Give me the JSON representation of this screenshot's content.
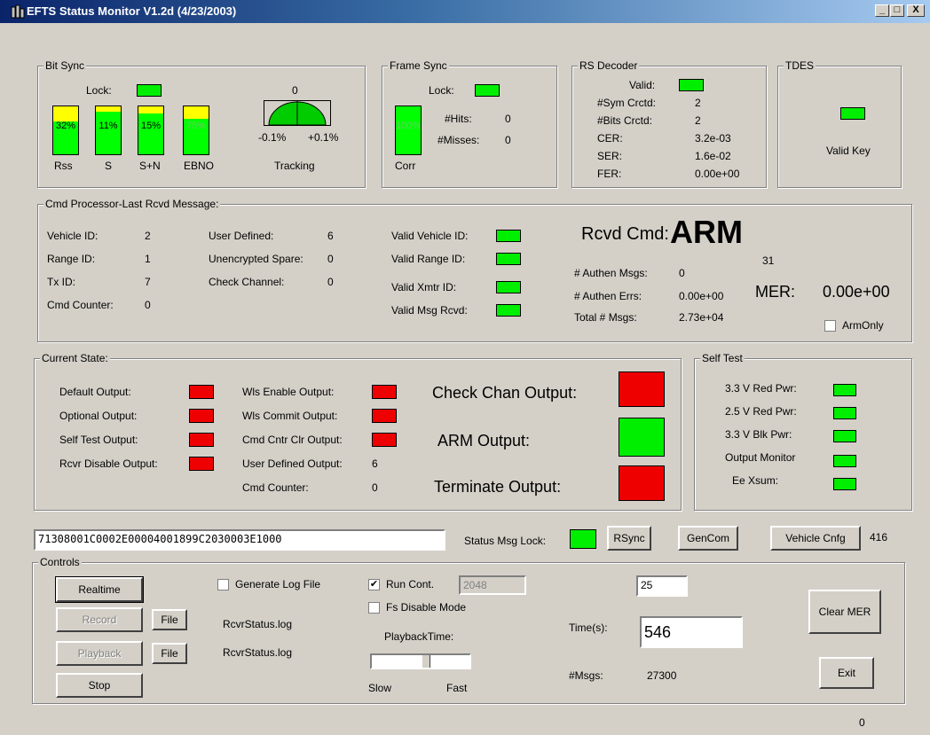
{
  "window": {
    "title": "EFTS Status Monitor V1.2d (4/23/2003)",
    "min": "_",
    "max": "□",
    "close": "X"
  },
  "bitsync": {
    "label": "Bit Sync",
    "lock_label": "Lock:",
    "bars": [
      {
        "pct": "32%",
        "label": "Rss",
        "value": 0.32
      },
      {
        "pct": "11%",
        "label": "S",
        "value": 0.11
      },
      {
        "pct": "15%",
        "label": "S+N",
        "value": 0.15
      },
      {
        "pct": "75%",
        "label": "EBNO",
        "value": 0.75
      }
    ],
    "tracking_value": "0",
    "tracking_min": "-0.1%",
    "tracking_max": "+0.1%",
    "tracking_label": "Tracking"
  },
  "framesync": {
    "label": "Frame Sync",
    "lock_label": "Lock:",
    "corr_pct": "100%",
    "corr_label": "Corr",
    "hits_label": "#Hits:",
    "hits": "0",
    "misses_label": "#Misses:",
    "misses": "0"
  },
  "rs": {
    "label": "RS Decoder",
    "valid_label": "Valid:",
    "rows": [
      {
        "k": "#Sym Crctd:",
        "v": "2"
      },
      {
        "k": "#Bits Crctd:",
        "v": "2"
      },
      {
        "k": "CER:",
        "v": "3.2e-03"
      },
      {
        "k": "SER:",
        "v": "1.6e-02"
      },
      {
        "k": "FER:",
        "v": "0.00e+00"
      }
    ]
  },
  "tdes": {
    "label": "TDES",
    "valid_key": "Valid Key"
  },
  "cmd": {
    "label": "Cmd Processor-Last Rcvd Message:",
    "left": [
      {
        "k": "Vehicle ID:",
        "v": "2"
      },
      {
        "k": "Range ID:",
        "v": "1"
      },
      {
        "k": "Tx ID:",
        "v": "7"
      },
      {
        "k": "Cmd Counter:",
        "v": "0"
      }
    ],
    "mid": [
      {
        "k": "User Defined:",
        "v": "6"
      },
      {
        "k": "Unencrypted Spare:",
        "v": "0"
      },
      {
        "k": "Check Channel:",
        "v": "0"
      }
    ],
    "valids": [
      "Valid Vehicle ID:",
      "Valid Range ID:",
      "Valid Xmtr ID:",
      "Valid Msg Rcvd:"
    ],
    "rcvd_label": "Rcvd Cmd:",
    "rcvd_value": "ARM",
    "rcvd_num": "31",
    "authen_msgs_label": "# Authen Msgs:",
    "authen_msgs": "0",
    "authen_errs_label": "# Authen Errs:",
    "authen_errs": "0.00e+00",
    "total_label": "Total # Msgs:",
    "total": "2.73e+04",
    "mer_label": "MER:",
    "mer": "0.00e+00",
    "armonly": "ArmOnly"
  },
  "state": {
    "label": "Current State:",
    "left": [
      "Default Output:",
      "Optional Output:",
      "Self Test Output:",
      "Rcvr Disable Output:"
    ],
    "mid": [
      "Wls Enable Output:",
      "Wls Commit Output:",
      "Cmd Cntr Clr Output:"
    ],
    "user_defined_label": "User Defined Output:",
    "user_defined": "6",
    "cmd_counter_label": "Cmd Counter:",
    "cmd_counter": "0",
    "check_chan": "Check Chan Output:",
    "arm": "ARM Output:",
    "terminate": "Terminate Output:"
  },
  "selftest": {
    "label": "Self Test",
    "rows": [
      "3.3 V Red Pwr:",
      "2.5 V Red Pwr:",
      "3.3 V Blk Pwr:",
      "Output Monitor",
      "Ee Xsum:"
    ]
  },
  "status": {
    "hex": "71308001C0002E00004001899C2030003E1000",
    "lock_label": "Status Msg Lock:",
    "rsync": "RSync",
    "gencom": "GenCom",
    "vehicle_cnfg": "Vehicle Cnfg",
    "count": "416"
  },
  "controls": {
    "label": "Controls",
    "realtime": "Realtime",
    "record": "Record",
    "playback": "Playback",
    "stop": "Stop",
    "file": "File",
    "log1": "RcvrStatus.log",
    "log2": "RcvrStatus.log",
    "generate_log": "Generate Log File",
    "run_cont": "Run Cont.",
    "run_cont_value": "2048",
    "fs_disable": "Fs Disable Mode",
    "playback_time": "PlaybackTime:",
    "slow": "Slow",
    "fast": "Fast",
    "field25": "25",
    "time_label": "Time(s):",
    "time": "546",
    "msgs_label": "#Msgs:",
    "msgs": "27300",
    "clear_mer": "Clear MER",
    "exit": "Exit"
  },
  "footer": {
    "value": "0"
  }
}
